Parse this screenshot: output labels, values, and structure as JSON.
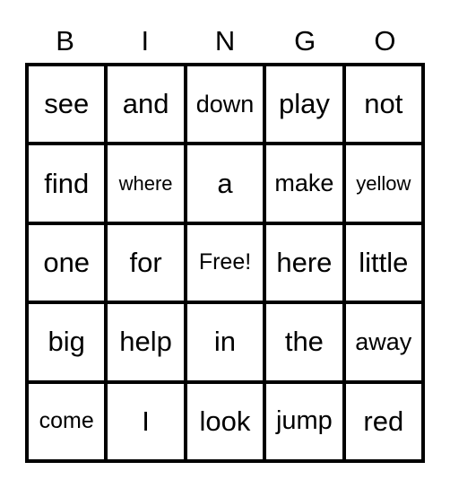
{
  "header": {
    "letters": [
      "B",
      "I",
      "N",
      "G",
      "O"
    ]
  },
  "grid": {
    "rows": [
      [
        {
          "word": "see",
          "size": "xl"
        },
        {
          "word": "and",
          "size": "xl"
        },
        {
          "word": "down",
          "size": "m"
        },
        {
          "word": "play",
          "size": "xl"
        },
        {
          "word": "not",
          "size": "xl"
        }
      ],
      [
        {
          "word": "find",
          "size": "xl"
        },
        {
          "word": "where",
          "size": "xs"
        },
        {
          "word": "a",
          "size": "xl"
        },
        {
          "word": "make",
          "size": "m"
        },
        {
          "word": "yellow",
          "size": "xs"
        }
      ],
      [
        {
          "word": "one",
          "size": "xl"
        },
        {
          "word": "for",
          "size": "xl"
        },
        {
          "word": "Free!",
          "size": "s"
        },
        {
          "word": "here",
          "size": "xl"
        },
        {
          "word": "little",
          "size": "xl"
        }
      ],
      [
        {
          "word": "big",
          "size": "xl"
        },
        {
          "word": "help",
          "size": "xl"
        },
        {
          "word": "in",
          "size": "xl"
        },
        {
          "word": "the",
          "size": "xl"
        },
        {
          "word": "away",
          "size": "m"
        }
      ],
      [
        {
          "word": "come",
          "size": "s"
        },
        {
          "word": "I",
          "size": "xl"
        },
        {
          "word": "look",
          "size": "xl"
        },
        {
          "word": "jump",
          "size": "l"
        },
        {
          "word": "red",
          "size": "xl"
        }
      ]
    ]
  }
}
